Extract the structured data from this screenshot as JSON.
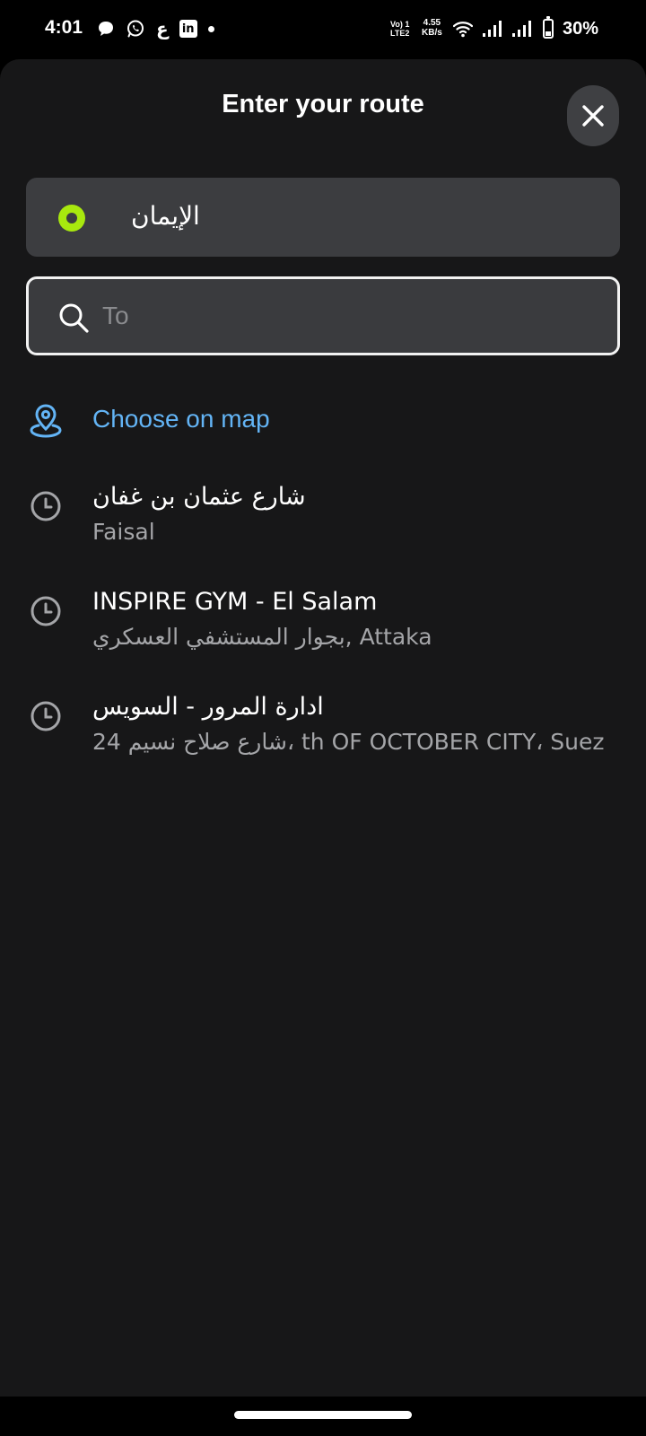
{
  "status_bar": {
    "time": "4:01",
    "notification_icons": [
      "chat-bubble-icon",
      "whatsapp-icon",
      "arabic-letter-icon",
      "linkedin-icon",
      "dot-icon"
    ],
    "arabic_glyph": "ع",
    "linkedin_glyph": "in",
    "volte_line1": "Vo) 1",
    "volte_line2": "LTE2",
    "speed_line1": "4.55",
    "speed_line2": "KB/s",
    "battery_percent": "30%",
    "battery_level": 0.3
  },
  "sheet": {
    "title": "Enter your route",
    "close_icon": "close-icon"
  },
  "route": {
    "from_value": "الإيمان",
    "from_dot_color": "#a8e80e",
    "to_placeholder": "To",
    "to_value": ""
  },
  "choose_on_map": {
    "label": "Choose on map",
    "icon": "map-pin-icon",
    "color": "#63b4f5"
  },
  "recent_places": [
    {
      "title": "شارع عثمان بن غفان",
      "subtitle": "Faisal"
    },
    {
      "title": "INSPIRE GYM - El Salam",
      "subtitle": "بجوار المستشفي العسكري, Attaka"
    },
    {
      "title": "ادارة المرور - السويس",
      "subtitle": "24 شارع صلاح نسيم، th OF OCTOBER CITY، Suez"
    }
  ]
}
